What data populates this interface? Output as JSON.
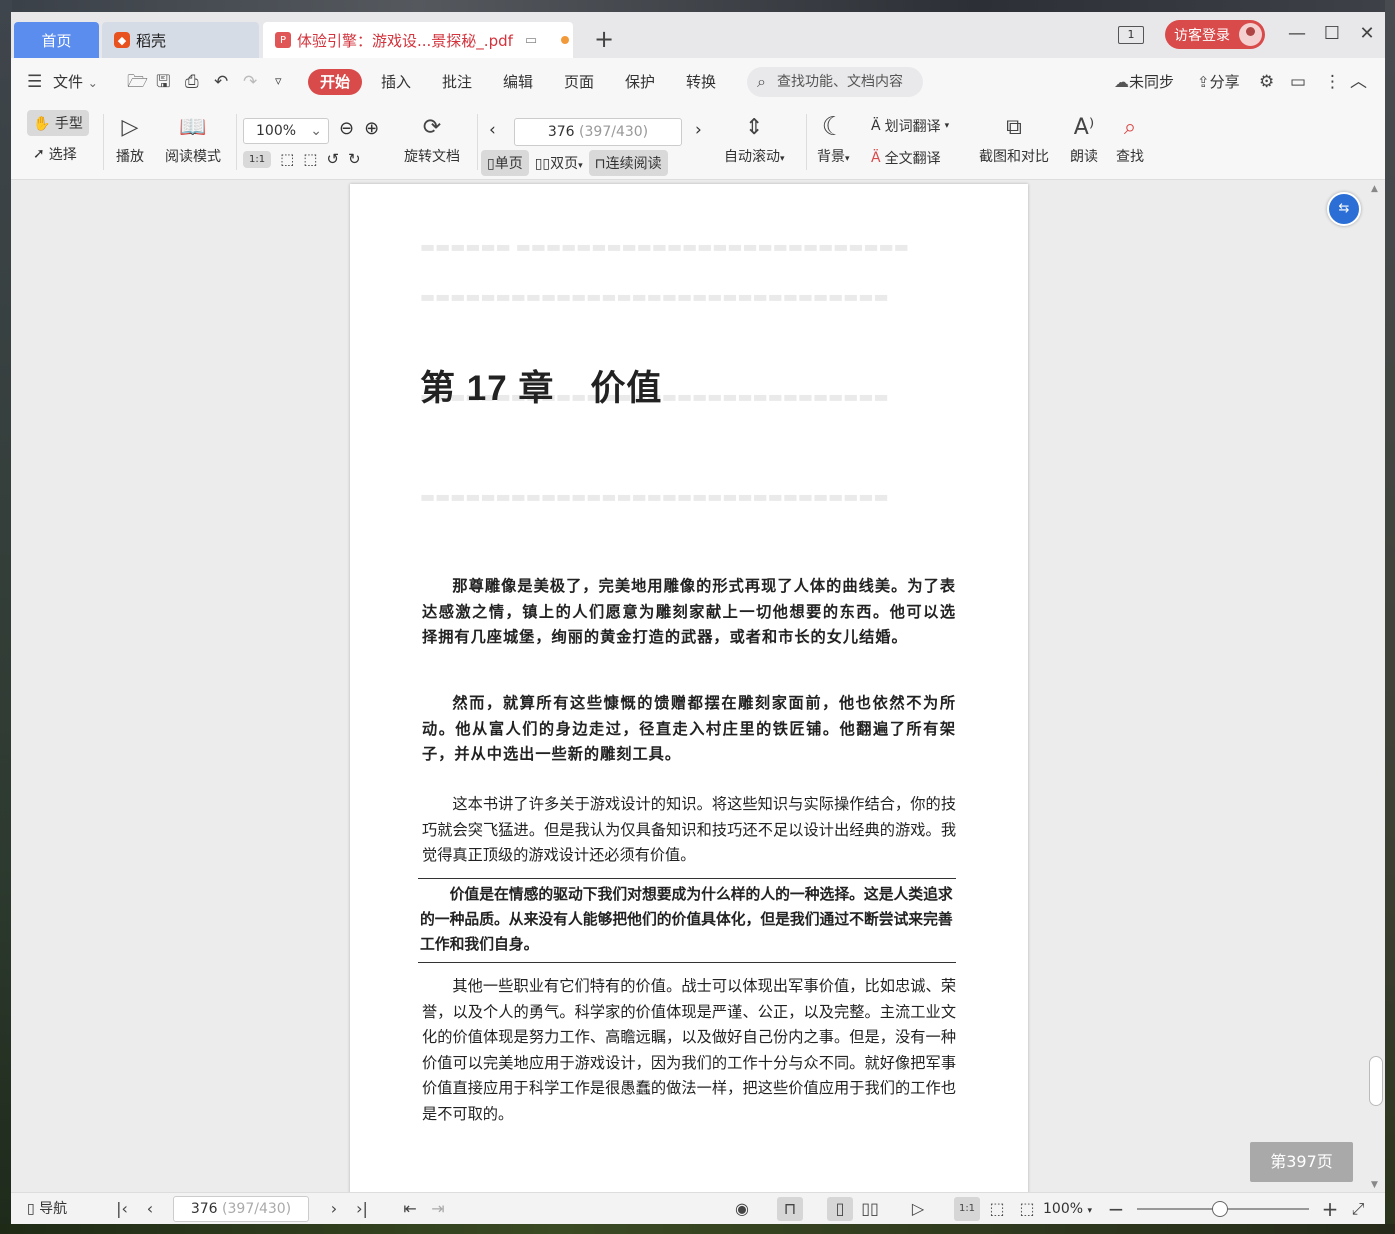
{
  "tabs": {
    "home": "首页",
    "daoke": "稻壳",
    "document": "体验引擎：游戏设...景探秘_.pdf",
    "add": "+"
  },
  "window": {
    "page_count_icon": "1",
    "login": "访客登录",
    "minimize": "—",
    "maximize": "☐",
    "close": "✕"
  },
  "menu": {
    "file": "文件",
    "items": [
      "开始",
      "插入",
      "批注",
      "编辑",
      "页面",
      "保护",
      "转换"
    ],
    "search_placeholder": "查找功能、文档内容",
    "sync": "未同步",
    "share": "分享"
  },
  "ribbon": {
    "hand": "手型",
    "select": "选择",
    "play": "播放",
    "read_mode": "阅读模式",
    "zoom": "100%",
    "rotate": "旋转文档",
    "page_current": "376",
    "page_total": "(397/430)",
    "single": "单页",
    "double": "双页",
    "continuous": "连续阅读",
    "auto_scroll": "自动滚动",
    "background": "背景",
    "word_translate": "划词翻译",
    "full_translate": "全文翻译",
    "screenshot_compare": "截图和对比",
    "read_aloud": "朗读",
    "find": "查找",
    "ratio_icon": "1:1"
  },
  "document": {
    "chapter_title": "第 17 章　价值",
    "para1": "那尊雕像是美极了，完美地用雕像的形式再现了人体的曲线美。为了表达感激之情，镇上的人们愿意为雕刻家献上一切他想要的东西。他可以选择拥有几座城堡，绚丽的黄金打造的武器，或者和市长的女儿结婚。",
    "para2": "然而，就算所有这些慷慨的馈赠都摆在雕刻家面前，他也依然不为所动。他从富人们的身边走过，径直走入村庄里的铁匠铺。他翻遍了所有架子，并从中选出一些新的雕刻工具。",
    "para3": "这本书讲了许多关于游戏设计的知识。将这些知识与实际操作结合，你的技巧就会突飞猛进。但是我认为仅具备知识和技巧还不足以设计出经典的游戏。我觉得真正顶级的游戏设计还必须有价值。",
    "quote": "价值是在情感的驱动下我们对想要成为什么样的人的一种选择。这是人类追求的一种品质。从来没有人能够把他们的价值具体化，但是我们通过不断尝试来完善工作和我们自身。",
    "para4": "其他一些职业有它们特有的价值。战士可以体现出军事价值，比如忠诚、荣誉，以及个人的勇气。科学家的价值体现是严谨、公正，以及完整。主流工业文化的价值体现是努力工作、高瞻远瞩，以及做好自己份内之事。但是，没有一种价值可以完美地应用于游戏设计，因为我们的工作十分与众不同。就好像把军事价值直接应用于科学工作是很愚蠢的做法一样，把这些价值应用于我们的工作也是不可取的。"
  },
  "page_badge": "第397页",
  "status": {
    "nav": "导航",
    "page_current": "376",
    "page_total": "(397/430)",
    "zoom": "100%",
    "ratio": "1:1"
  },
  "colors": {
    "accent_red": "#d94a4a",
    "home_tab_blue": "#5b8def",
    "float_blue": "#2b6fd6"
  }
}
